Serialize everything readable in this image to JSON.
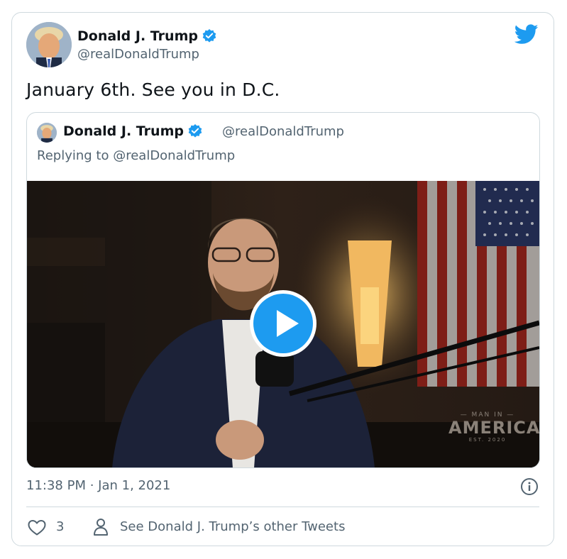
{
  "tweet": {
    "author_name": "Donald J. Trump",
    "author_handle": "@realDonaldTrump",
    "text": "January 6th. See you in D.C.",
    "timestamp": "11:38 PM · Jan 1, 2021",
    "like_count": "3",
    "other_tweets_label": "See Donald J. Trump’s other Tweets"
  },
  "quoted": {
    "author_name": "Donald J. Trump",
    "author_handle": "@realDonaldTrump",
    "replying_prefix": "Replying to ",
    "replying_to": "@realDonaldTrump"
  },
  "media": {
    "type": "video",
    "watermark_top": "— MAN IN —",
    "watermark_main": "AMERICA",
    "watermark_est": "EST. 2020"
  },
  "icons": {
    "verified": "verified-badge-icon",
    "brand": "twitter-bird-icon",
    "play": "play-icon",
    "info": "info-icon",
    "like": "heart-icon",
    "profile": "person-icon"
  },
  "colors": {
    "accent": "#1d9bf0",
    "text": "#0f1419",
    "secondary": "#536471",
    "border": "#cfd9de"
  }
}
